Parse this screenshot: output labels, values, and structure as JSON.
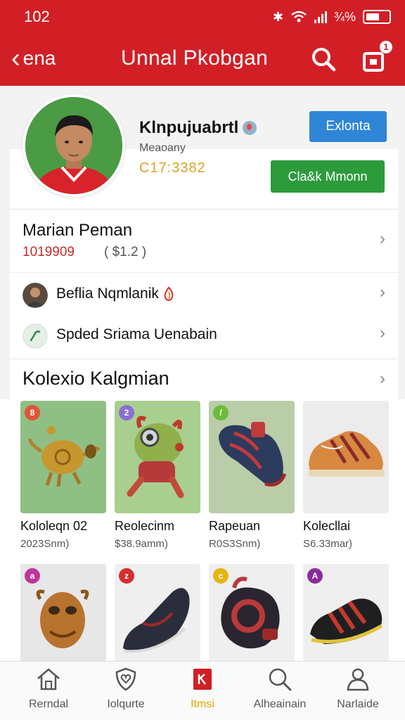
{
  "status": {
    "time": "102",
    "battery_text": "¾%"
  },
  "appbar": {
    "back_label": "ena",
    "title": "Unnal Pkobgan",
    "cart_badge": "1"
  },
  "profile": {
    "name": "Klnpujuabrtl",
    "subtitle": "Meaoany",
    "number": "C17:3382",
    "button_primary": "Exlonta",
    "button_secondary": "Cla&k Mmonn"
  },
  "list": {
    "row1_title": "Marian Peman",
    "row1_number": "1019909",
    "row1_price": "( $1.2  )",
    "row2_label": "Beflia Nqmlanik",
    "row3_label": "Spded Sriama Uenabain"
  },
  "collection": {
    "title": "Kolexio Kalgmian",
    "items": [
      {
        "name": "Kololeqn 02",
        "price": "2023Snm)",
        "tag": "8",
        "tag_color": "#e0533a"
      },
      {
        "name": "Reolecinm",
        "price": "$38.9amm)",
        "tag": "2",
        "tag_color": "#8b6fd0"
      },
      {
        "name": "Rapeuan",
        "price": "R0S3Snm)",
        "tag": "/",
        "tag_color": "#6dbb3a"
      },
      {
        "name": "Kolecllai",
        "price": "S6.33mar)",
        "tag": "",
        "tag_color": ""
      },
      {
        "name": "",
        "price": "",
        "tag": "a",
        "tag_color": "#c0359a"
      },
      {
        "name": "",
        "price": "",
        "tag": "z",
        "tag_color": "#d23030"
      },
      {
        "name": "",
        "price": "",
        "tag": "c",
        "tag_color": "#e6b514"
      },
      {
        "name": "",
        "price": "",
        "tag": "A",
        "tag_color": "#8a2c9c"
      }
    ]
  },
  "bottom_nav": [
    {
      "label": "Rerndal",
      "icon": "home-icon"
    },
    {
      "label": "Iolqurte",
      "icon": "shield-heart-icon"
    },
    {
      "label": "Itmsi",
      "icon": "bookmark-icon",
      "active": true
    },
    {
      "label": "Alheainain",
      "icon": "search-icon"
    },
    {
      "label": "Narlaide",
      "icon": "user-icon"
    }
  ],
  "colors": {
    "brand_red": "#d21f26",
    "primary_blue": "#2f86d6",
    "success_green": "#2d9a3c",
    "active_nav": "#e4a400"
  }
}
